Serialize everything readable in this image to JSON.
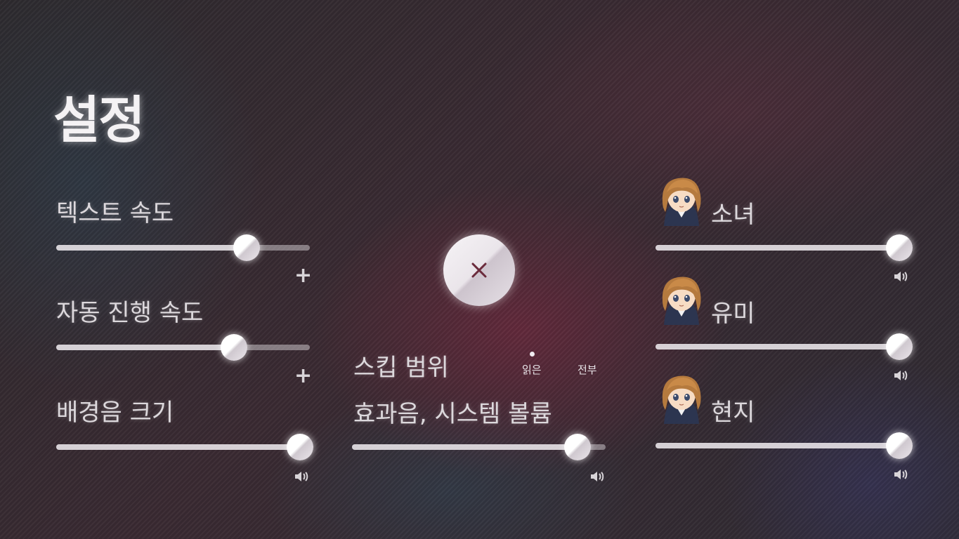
{
  "title": "설정",
  "text_speed": {
    "label": "텍스트 속도",
    "value": 0.75
  },
  "auto_speed": {
    "label": "자동 진행 속도",
    "value": 0.7
  },
  "bgm_volume": {
    "label": "배경음 크기",
    "value": 0.96
  },
  "skip": {
    "label": "스킵 범위",
    "options": [
      "읽은",
      "전부"
    ],
    "selected": "읽은"
  },
  "se_volume": {
    "label": "효과음, 시스템 볼륨",
    "value": 0.89
  },
  "voices": [
    {
      "name": "소녀",
      "value": 0.96
    },
    {
      "name": "유미",
      "value": 0.96
    },
    {
      "name": "현지",
      "value": 0.96
    }
  ],
  "icons": {
    "close": "close-icon",
    "plus": "plus-icon",
    "speaker": "speaker-icon"
  },
  "colors": {
    "knob": "#ffffff",
    "track": "#e6e2e6",
    "close_x": "#6b2b3c"
  }
}
